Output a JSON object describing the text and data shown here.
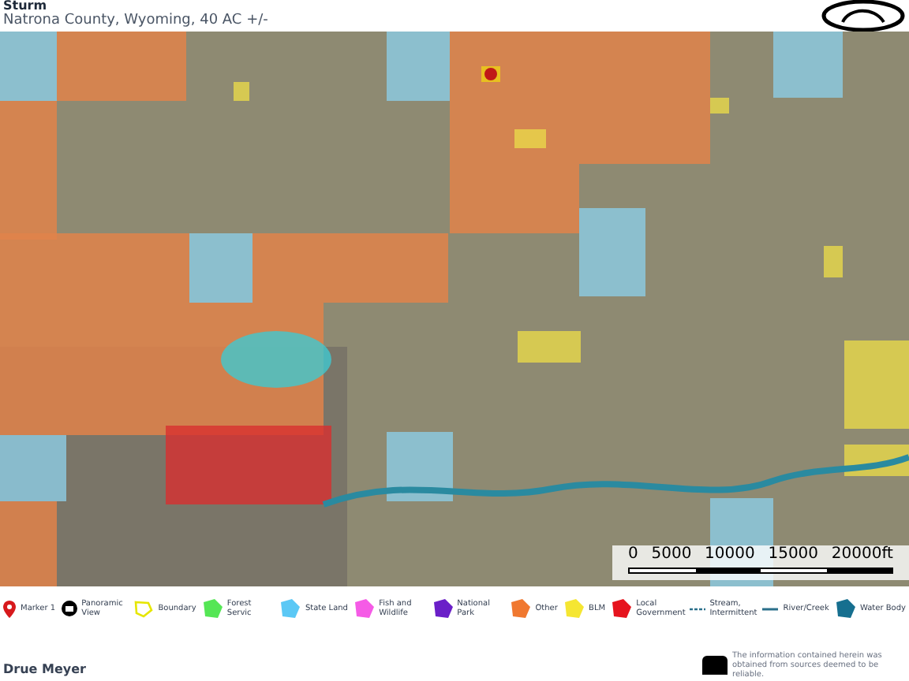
{
  "header": {
    "title": "Sturm",
    "subtitle": "Natrona County, Wyoming, 40 AC +/-"
  },
  "scale_bar": {
    "labels": [
      "0",
      "5000",
      "10000",
      "15000",
      "20000ft"
    ]
  },
  "legend": [
    {
      "kind": "marker",
      "label": "Marker 1",
      "color": "#d7191c"
    },
    {
      "kind": "pano",
      "label": "Panoramic View",
      "color": "#000000"
    },
    {
      "kind": "outline",
      "label": "Boundary",
      "color": "#e6e600"
    },
    {
      "kind": "polygon",
      "label": "Forest Servic",
      "color": "#55e655"
    },
    {
      "kind": "polygon",
      "label": "State Land",
      "color": "#5bc8f5"
    },
    {
      "kind": "polygon",
      "label": "Fish and Wildlife",
      "color": "#f55be6"
    },
    {
      "kind": "polygon",
      "label": "National Park",
      "color": "#6a1fc8"
    },
    {
      "kind": "polygon",
      "label": "Other",
      "color": "#f07830"
    },
    {
      "kind": "polygon",
      "label": "BLM",
      "color": "#f5e632"
    },
    {
      "kind": "polygon",
      "label": "Local Government",
      "color": "#e6141e"
    },
    {
      "kind": "dashed",
      "label": "Stream, Intermittent",
      "color": "#2a6f8a"
    },
    {
      "kind": "line",
      "label": "River/Creek",
      "color": "#2a6f8a"
    },
    {
      "kind": "polygon",
      "label": "Water Body",
      "color": "#166f8f"
    }
  ],
  "footer": {
    "agent": "Drue Meyer",
    "disclaimer": "The information contained herein was obtained from sources deemed to be reliable."
  }
}
